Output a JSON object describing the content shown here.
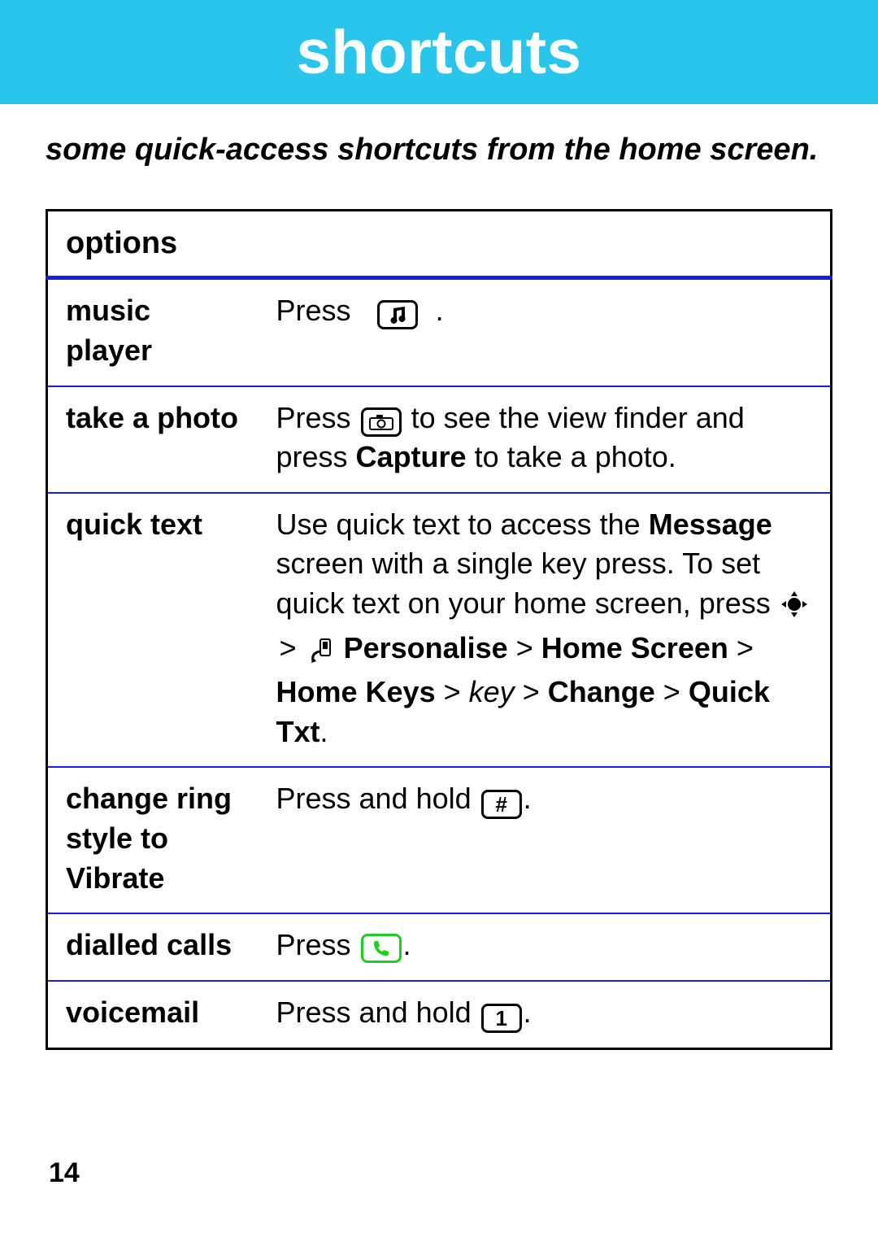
{
  "banner": {
    "title": "shortcuts"
  },
  "intro": "some quick-access shortcuts from the home screen.",
  "table": {
    "header": "options",
    "rows": {
      "music": {
        "label": "music player",
        "press": "Press",
        "period": "."
      },
      "photo": {
        "label": "take a photo",
        "press": "Press",
        "tail": " to see the view finder and press ",
        "capture": "Capture",
        "tail2": " to take a photo."
      },
      "quick": {
        "label": "quick text",
        "lead": "Use quick text to access the ",
        "message": "Message",
        "mid": " screen with a single key press. To set quick text on your home screen, press ",
        "path1": "Personalise",
        "path2": "Home Screen",
        "path3": "Home Keys",
        "key": "key",
        "path4": "Change",
        "path5": "Quick Txt",
        "gt": ">",
        "period": "."
      },
      "ring": {
        "label": "change ring style  to Vibrate",
        "press": "Press and hold",
        "hash": "#",
        "period": "."
      },
      "dialled": {
        "label": "dialled calls",
        "press": "Press",
        "period": "."
      },
      "voicemail": {
        "label": "voicemail",
        "press": "Press and hold",
        "one": "1",
        "period": "."
      }
    }
  },
  "page_number": "14"
}
